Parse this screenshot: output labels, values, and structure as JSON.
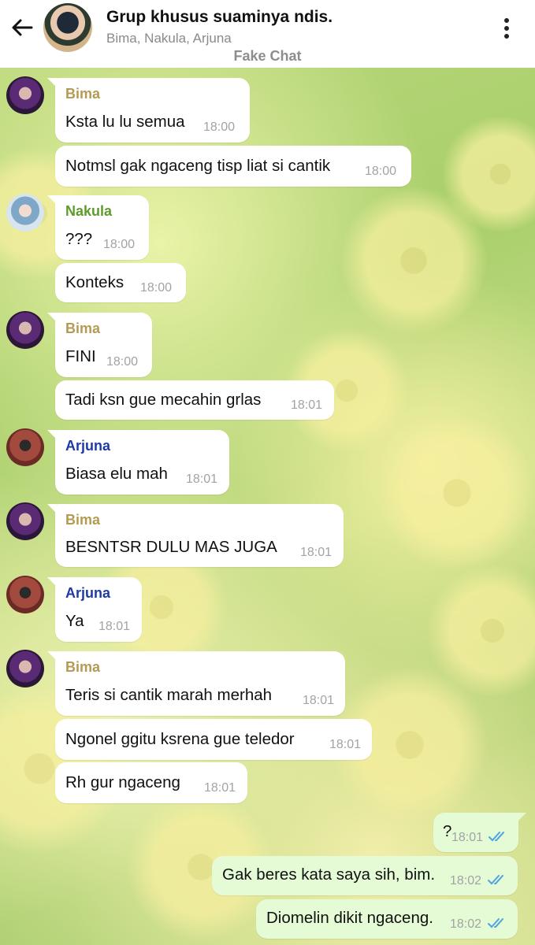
{
  "header": {
    "title": "Grup khusus suaminya ndis.",
    "members": "Bima, Nakula, Arjuna",
    "watermark": "Fake Chat"
  },
  "colors": {
    "bima": "#b59a52",
    "nakula": "#5e9c2a",
    "arjuna": "#1f3aa7",
    "outgoing_bubble": "#e4fbd6",
    "read_check": "#4fa3e0"
  },
  "messages": [
    {
      "sender": "Bima",
      "text": "Ksta lu lu semua",
      "time": "18:00"
    },
    {
      "text": "Notmsl gak ngaceng tisp liat si cantik",
      "time": "18:00"
    },
    {
      "sender": "Nakula",
      "text": "???",
      "time": "18:00"
    },
    {
      "text": "Konteks",
      "time": "18:00"
    },
    {
      "sender": "Bima",
      "text": "FINI",
      "time": "18:00"
    },
    {
      "text": "Tadi ksn gue mecahin grlas",
      "time": "18:01"
    },
    {
      "sender": "Arjuna",
      "text": "Biasa elu mah",
      "time": "18:01"
    },
    {
      "sender": "Bima",
      "text": "BESNTSR DULU MAS JUGA",
      "time": "18:01"
    },
    {
      "sender": "Arjuna",
      "text": "Ya",
      "time": "18:01"
    },
    {
      "sender": "Bima",
      "text": "Teris si cantik marah merhah",
      "time": "18:01"
    },
    {
      "text": "Ngonel ggitu ksrena gue teledor",
      "time": "18:01"
    },
    {
      "text": "Rh gur ngaceng",
      "time": "18:01"
    }
  ],
  "outgoing": [
    {
      "text": "?",
      "time": "18:01"
    },
    {
      "text": "Gak beres kata saya sih, bim.",
      "time": "18:02"
    },
    {
      "text": "Diomelin dikit ngaceng.",
      "time": "18:02"
    }
  ]
}
